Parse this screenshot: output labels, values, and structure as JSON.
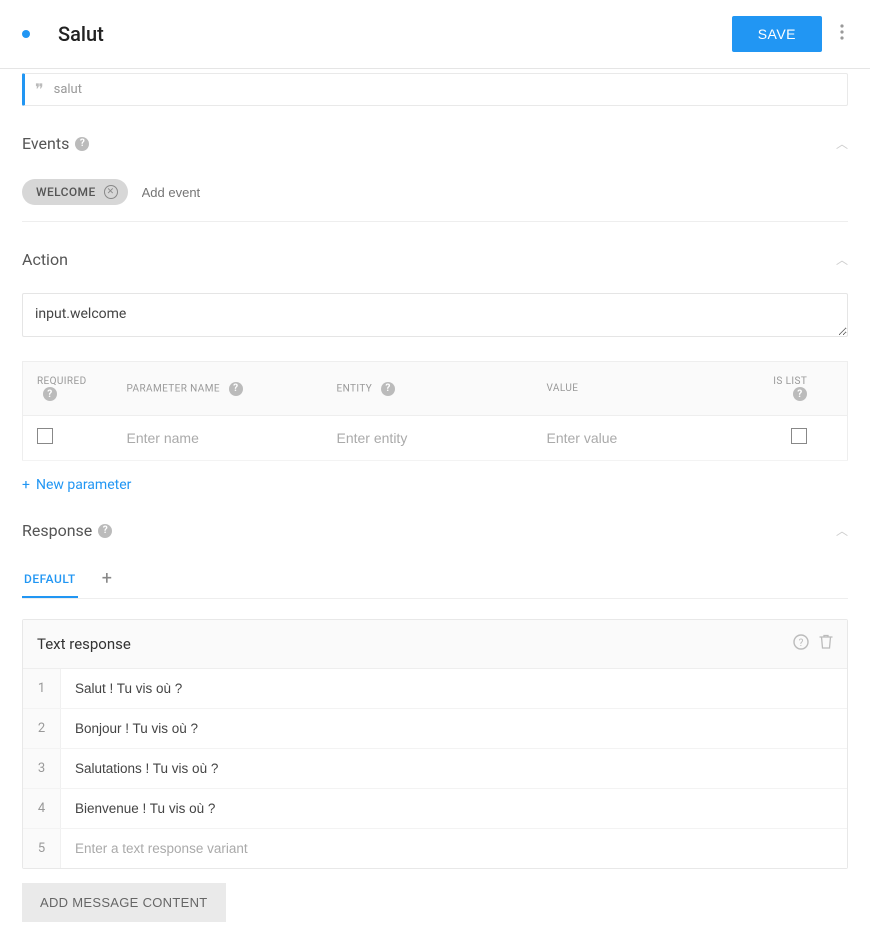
{
  "header": {
    "title": "Salut",
    "save_label": "SAVE"
  },
  "quote": {
    "text": "salut"
  },
  "events": {
    "heading": "Events",
    "chip": "WELCOME",
    "add_placeholder": "Add event"
  },
  "action": {
    "heading": "Action",
    "value": "input.welcome",
    "table": {
      "headers": {
        "required": "REQUIRED",
        "param_name": "PARAMETER NAME",
        "entity": "ENTITY",
        "value": "VALUE",
        "is_list": "IS LIST"
      },
      "placeholders": {
        "name": "Enter name",
        "entity": "Enter entity",
        "value": "Enter value"
      }
    },
    "new_param_label": "New parameter"
  },
  "response": {
    "heading": "Response",
    "tab_default": "DEFAULT",
    "card_title": "Text response",
    "variants": [
      "Salut ! Tu vis où ?",
      "Bonjour ! Tu vis où ?",
      "Salutations ! Tu vis où ?",
      "Bienvenue ! Tu vis où ?"
    ],
    "variant_placeholder": "Enter a text response variant",
    "add_content_label": "ADD MESSAGE CONTENT"
  }
}
